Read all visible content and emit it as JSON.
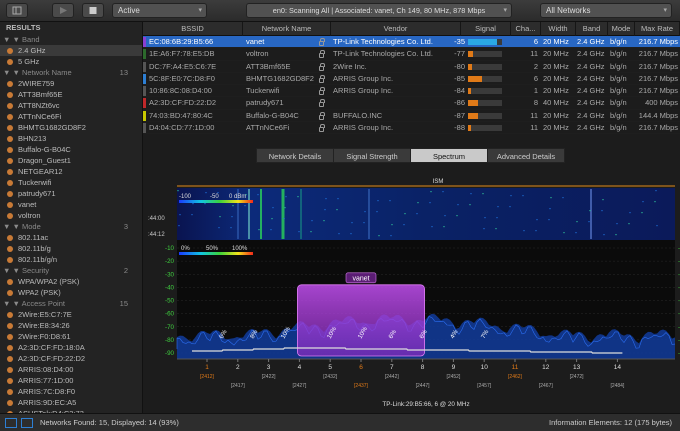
{
  "toolbar": {
    "filter_value": "Active",
    "status_text": "en0: Scanning All  |  Associated: vanet, Ch 149, 80 MHz, 878 Mbps",
    "network_filter": "All Networks",
    "icons": [
      "grid-icon",
      "play-icon",
      "stop-icon",
      "search-icon"
    ]
  },
  "sidebar": {
    "title": "RESULTS",
    "sections": [
      {
        "label": "Band",
        "count": "",
        "items": [
          {
            "label": "2.4 GHz",
            "active": true
          },
          {
            "label": "5 GHz",
            "active": false
          }
        ]
      },
      {
        "label": "Network Name",
        "count": "13",
        "items": [
          {
            "label": "2WIRE759"
          },
          {
            "label": "ATT3Bmf65E"
          },
          {
            "label": "ATT8NZt6vc"
          },
          {
            "label": "ATTnNCe6Fi"
          },
          {
            "label": "BHMTG1682GD8F2"
          },
          {
            "label": "BHN213"
          },
          {
            "label": "Buffalo-G-B04C"
          },
          {
            "label": "Dragon_Guest1"
          },
          {
            "label": "NETGEAR12"
          },
          {
            "label": "Tuckerwifi"
          },
          {
            "label": "patrudy671"
          },
          {
            "label": "vanet"
          },
          {
            "label": "voltron"
          }
        ]
      },
      {
        "label": "Mode",
        "count": "3",
        "items": [
          {
            "label": "802.11ac"
          },
          {
            "label": "802.11b/g"
          },
          {
            "label": "802.11b/g/n"
          }
        ]
      },
      {
        "label": "Security",
        "count": "2",
        "items": [
          {
            "label": "WPA/WPA2 (PSK)"
          },
          {
            "label": "WPA2 (PSK)"
          }
        ]
      },
      {
        "label": "Access Point",
        "count": "15",
        "items": [
          {
            "label": "2Wire:E5:C7:7E"
          },
          {
            "label": "2Wire:E8:34:26"
          },
          {
            "label": "2Wire:F0:D8:61"
          },
          {
            "label": "A2:3D:CF:FD:18:0A"
          },
          {
            "label": "A2:3D:CF:FD:22:D2"
          },
          {
            "label": "ARRIS:08:D4:00"
          },
          {
            "label": "ARRIS:77:1D:00"
          },
          {
            "label": "ARRIS:7C:D8:F0"
          },
          {
            "label": "ARRIS:9D:EC:A5"
          },
          {
            "label": "ASUSTek:D4:C3:73"
          }
        ]
      }
    ]
  },
  "table": {
    "columns": [
      "BSSID",
      "Network Name",
      "Vendor",
      "Signal",
      "Cha...",
      "Width",
      "Band",
      "Mode",
      "Max Rate"
    ],
    "rows": [
      {
        "color": "#8a3fd1",
        "bssid": "EC:08:6B:29:B5:66",
        "name": "vanet",
        "lock": true,
        "vendor": "TP-Link Technologies Co. Ltd.",
        "signal": "-35",
        "sigfrac": 0.85,
        "sigcolor": "#2aa8e6",
        "channel": "6",
        "width": "20 MHz",
        "band": "2.4 GHz",
        "mode": "b/g/n",
        "rate": "216.7 Mbps",
        "selected": true
      },
      {
        "color": "#2c6a2c",
        "bssid": "1E:A6:F7:78:E5:DB",
        "name": "voltron",
        "lock": true,
        "vendor": "TP-Link Technologies Co. Ltd.",
        "signal": "-77",
        "sigfrac": 0.15,
        "sigcolor": "#e07a18",
        "channel": "11",
        "width": "20 MHz",
        "band": "2.4 GHz",
        "mode": "b/g/n",
        "rate": "216.7 Mbps",
        "selected": false
      },
      {
        "color": "#555555",
        "bssid": "DC:7F:A4:E5:C6:7E",
        "name": "ATT3Bmf65E",
        "lock": true,
        "vendor": "2Wire Inc.",
        "signal": "-80",
        "sigfrac": 0.12,
        "sigcolor": "#e07a18",
        "channel": "2",
        "width": "20 MHz",
        "band": "2.4 GHz",
        "mode": "b/g/n",
        "rate": "216.7 Mbps",
        "selected": false
      },
      {
        "color": "#2d7fd4",
        "bssid": "5C:8F:E0:7C:D8:F0",
        "name": "BHMTG1682GD8F2",
        "lock": true,
        "vendor": "ARRIS Group Inc.",
        "signal": "-85",
        "sigfrac": 0.4,
        "sigcolor": "#e07a18",
        "channel": "6",
        "width": "20 MHz",
        "band": "2.4 GHz",
        "mode": "b/g/n",
        "rate": "216.7 Mbps",
        "selected": false
      },
      {
        "color": "#555555",
        "bssid": "10:86:8C:08:D4:00",
        "name": "Tuckerwifi",
        "lock": true,
        "vendor": "ARRIS Group Inc.",
        "signal": "-84",
        "sigfrac": 0.1,
        "sigcolor": "#e07a18",
        "channel": "1",
        "width": "20 MHz",
        "band": "2.4 GHz",
        "mode": "b/g/n",
        "rate": "216.7 Mbps",
        "selected": false
      },
      {
        "color": "#c0282a",
        "bssid": "A2:3D:CF:FD:22:D2",
        "name": "patrudy671",
        "lock": true,
        "vendor": "",
        "signal": "-86",
        "sigfrac": 0.3,
        "sigcolor": "#e07a18",
        "channel": "8",
        "width": "40 MHz",
        "band": "2.4 GHz",
        "mode": "b/g/n",
        "rate": "400 Mbps",
        "selected": false
      },
      {
        "color": "#c8c800",
        "bssid": "74:03:BD:47:80:4C",
        "name": "Buffalo-G-B04C",
        "lock": true,
        "vendor": "BUFFALO.INC",
        "signal": "-87",
        "sigfrac": 0.3,
        "sigcolor": "#e07a18",
        "channel": "11",
        "width": "20 MHz",
        "band": "2.4 GHz",
        "mode": "b/g/n",
        "rate": "144.4 Mbps",
        "selected": false
      },
      {
        "color": "#555555",
        "bssid": "D4:04:CD:77:1D:00",
        "name": "ATTnNCe6Fi",
        "lock": true,
        "vendor": "ARRIS Group Inc.",
        "signal": "-88",
        "sigfrac": 0.08,
        "sigcolor": "#e07a18",
        "channel": "11",
        "width": "20 MHz",
        "band": "2.4 GHz",
        "mode": "b/g/n",
        "rate": "216.7 Mbps",
        "selected": false
      }
    ]
  },
  "tabs": [
    {
      "label": "Network Details",
      "active": false
    },
    {
      "label": "Signal Strength",
      "active": false
    },
    {
      "label": "Spectrum",
      "active": true
    },
    {
      "label": "Advanced Details",
      "active": false
    }
  ],
  "spectrum": {
    "ism_label": "ISM",
    "dbm_labels": [
      "-100",
      "-50",
      "0 dBm"
    ],
    "time_labels": [
      ":44:00",
      ":44:12"
    ],
    "percent_labels": [
      "0%",
      "50%",
      "100%"
    ],
    "y_axis": [
      "-10",
      "-20",
      "-30",
      "-40",
      "-50",
      "-60",
      "-70",
      "-80",
      "-90"
    ],
    "highlight_label": "vanet",
    "util_labels": [
      {
        "text": "6%",
        "ch": 1.5
      },
      {
        "text": "8%",
        "ch": 2.5
      },
      {
        "text": "10%",
        "ch": 3.5
      },
      {
        "text": "10%",
        "ch": 5
      },
      {
        "text": "10%",
        "ch": 6
      },
      {
        "text": "6%",
        "ch": 7
      },
      {
        "text": "6%",
        "ch": 8
      },
      {
        "text": "4%",
        "ch": 9
      },
      {
        "text": "7%",
        "ch": 10
      }
    ],
    "channels": [
      {
        "ch": "1",
        "freq": "[2412]",
        "orange": true
      },
      {
        "ch": "2",
        "freq": "[2417]",
        "orange": false
      },
      {
        "ch": "3",
        "freq": "[2422]",
        "orange": false
      },
      {
        "ch": "4",
        "freq": "[2427]",
        "orange": false
      },
      {
        "ch": "5",
        "freq": "[2432]",
        "orange": false
      },
      {
        "ch": "6",
        "freq": "[2437]",
        "orange": true
      },
      {
        "ch": "7",
        "freq": "[2442]",
        "orange": false
      },
      {
        "ch": "8",
        "freq": "[2447]",
        "orange": false
      },
      {
        "ch": "9",
        "freq": "[2452]",
        "orange": false
      },
      {
        "ch": "10",
        "freq": "[2457]",
        "orange": false
      },
      {
        "ch": "11",
        "freq": "[2462]",
        "orange": true
      },
      {
        "ch": "12",
        "freq": "[2467]",
        "orange": false
      },
      {
        "ch": "13",
        "freq": "[2472]",
        "orange": false
      },
      {
        "ch": "14",
        "freq": "[2484]",
        "orange": false
      }
    ],
    "caption": "TP-Link:29:B5:66, 6 @ 20 MHz"
  },
  "status": {
    "left": "Networks Found: 15, Displayed: 14 (93%)",
    "right": "Information Elements: 12 (175 bytes)"
  }
}
